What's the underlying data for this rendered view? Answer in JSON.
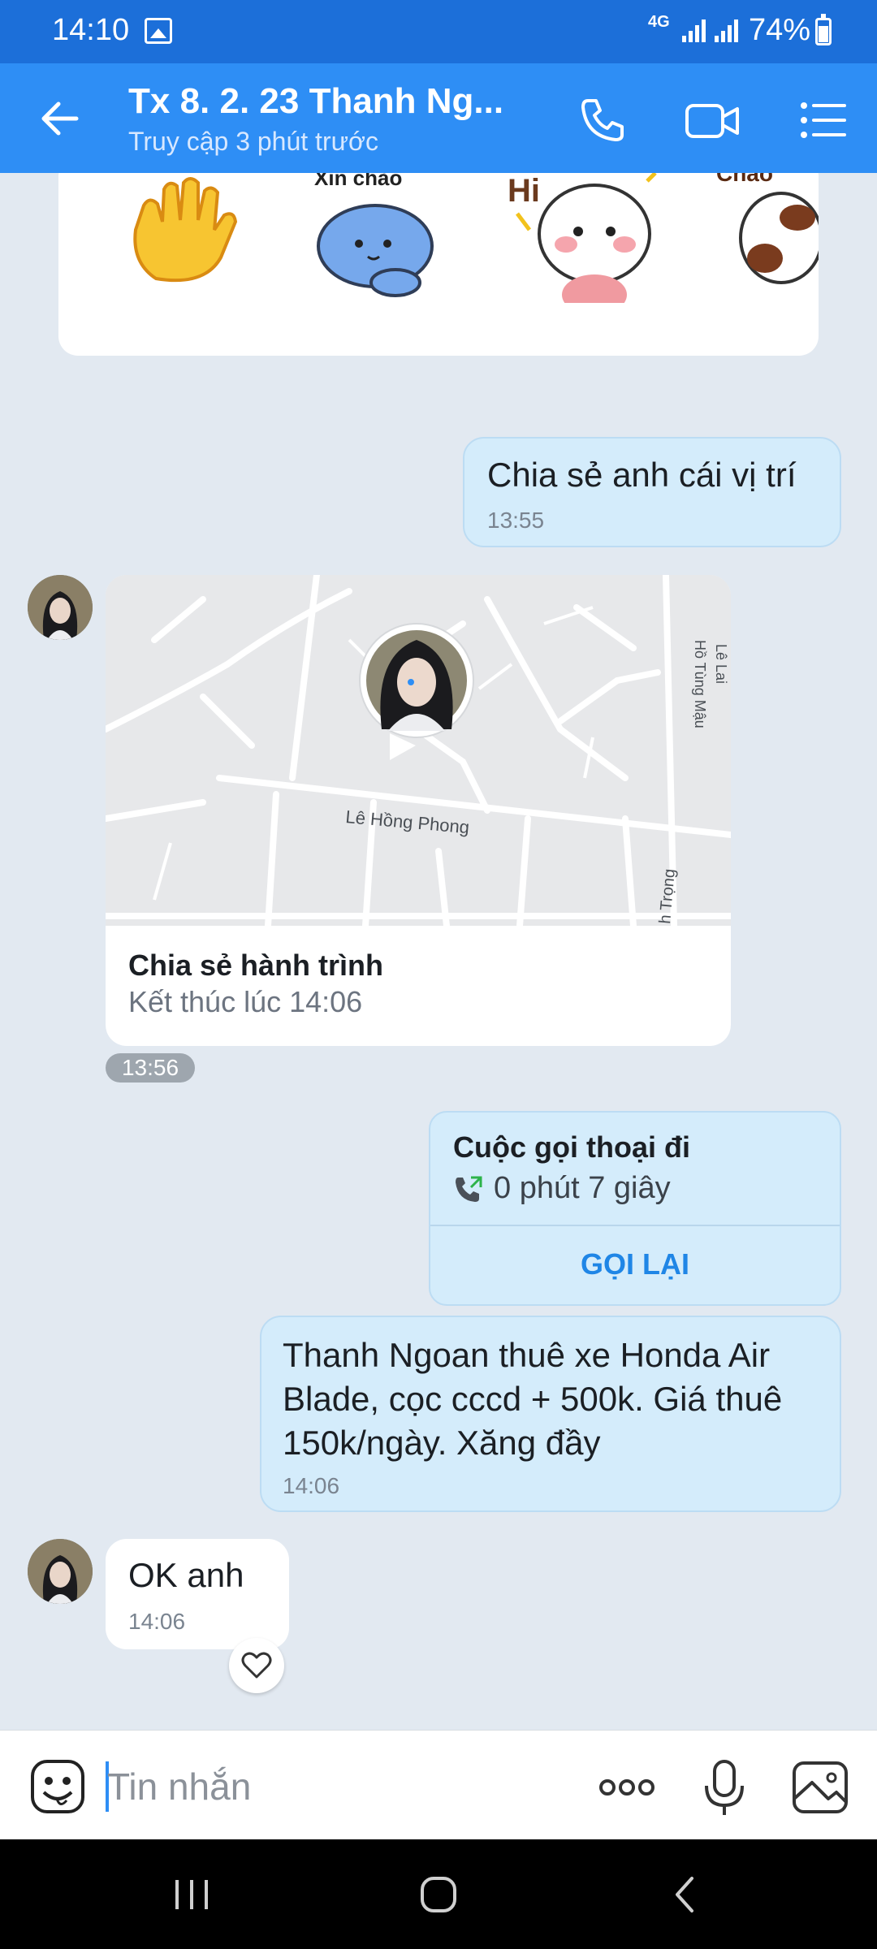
{
  "status_bar": {
    "time": "14:10",
    "network": "4G",
    "battery": "74%"
  },
  "header": {
    "title": "Tx 8. 2. 23 Thanh Ng...",
    "subtitle": "Truy cập 3 phút trước"
  },
  "stickers": {
    "blue_cat_caption": "Xin chào",
    "bunny_caption": "Hi",
    "dog_caption": "Chào"
  },
  "messages": {
    "location_request": {
      "text": "Chia sẻ anh cái vị trí",
      "time": "13:55"
    },
    "location_share": {
      "title": "Chia sẻ hành trình",
      "subtitle": "Kết thúc lúc 14:06",
      "time": "13:56",
      "map_labels": {
        "main_road": "Lê Hồng Phong",
        "road_le_lai": "Lê Lai",
        "road_ho_tung_mau": "Hồ Tùng Mậu",
        "road_trong": "h Trọng"
      }
    },
    "call": {
      "title": "Cuộc gọi thoại đi",
      "duration": "0 phút 7 giây",
      "action": "GỌI LẠI"
    },
    "rental": {
      "text": "Thanh Ngoan thuê xe Honda Air Blade, cọc cccd + 500k. Giá thuê 150k/ngày. Xăng đầy",
      "time": "14:06"
    },
    "reply": {
      "text": "OK anh",
      "time": "14:06"
    }
  },
  "composer": {
    "placeholder": "Tin nhắn"
  },
  "icons": {
    "back": "arrow-left-icon",
    "call": "phone-icon",
    "video": "video-camera-icon",
    "menu": "list-icon",
    "emoji": "emoji-icon",
    "more": "more-icon",
    "mic": "microphone-icon",
    "gallery": "image-icon",
    "heart": "heart-icon"
  },
  "colors": {
    "header": "#2e8ef5",
    "status_bar": "#1c6fd9",
    "outgoing_bubble": "#d4ecfb",
    "action": "#1f86e6"
  }
}
